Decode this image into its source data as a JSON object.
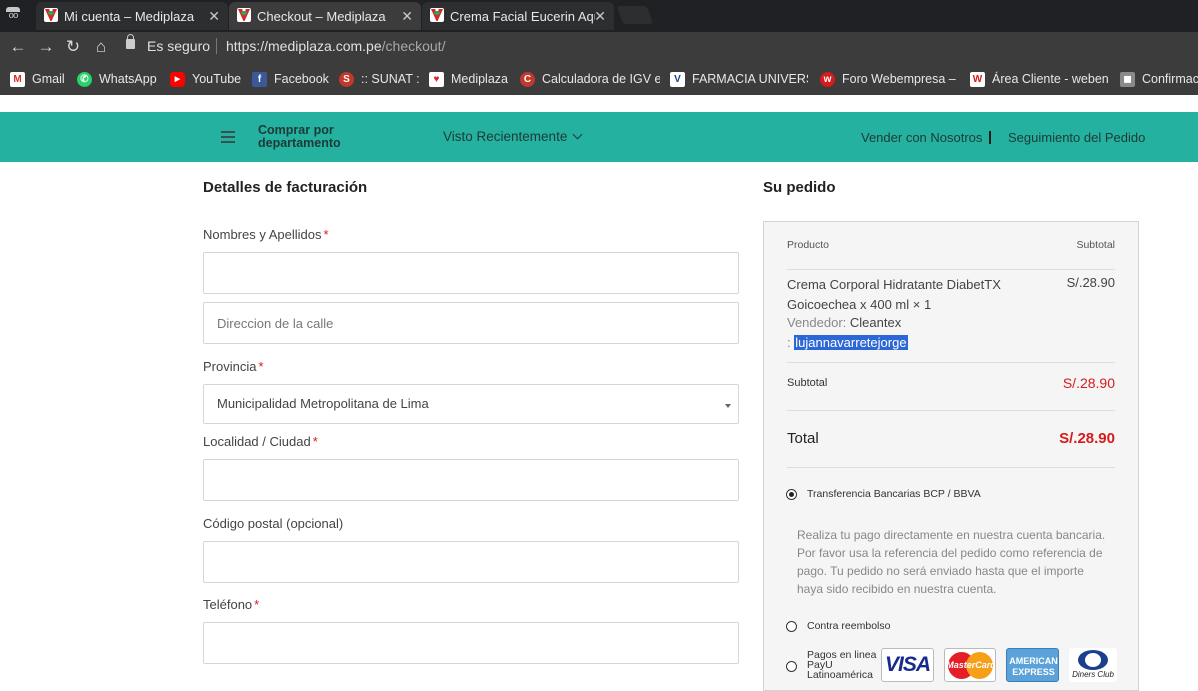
{
  "browser": {
    "tabs": [
      {
        "label": "Mi cuenta – Mediplaza",
        "active": false
      },
      {
        "label": "Checkout – Mediplaza",
        "active": true
      },
      {
        "label": "Crema Facial Eucerin Aqu",
        "active": false
      }
    ],
    "close_glyph": "✕",
    "nav": {
      "back": "←",
      "forward": "→",
      "reload": "↻",
      "home": "⌂"
    },
    "address": {
      "secure_label": "Es seguro",
      "url_host": "https://mediplaza.com.pe",
      "url_path": "/checkout/"
    },
    "bookmarks": [
      {
        "label": "Gmail",
        "icon": "gmail-icon",
        "color": "#d93025",
        "glyph": "M"
      },
      {
        "label": "WhatsApp",
        "icon": "whatsapp-icon",
        "color": "#25d366",
        "glyph": "✆"
      },
      {
        "label": "YouTube",
        "icon": "youtube-icon",
        "color": "#ff0000",
        "glyph": "▶"
      },
      {
        "label": "Facebook",
        "icon": "facebook-icon",
        "color": "#3b5998",
        "glyph": "f"
      },
      {
        "label": ":: SUNAT ::",
        "icon": "sunat-icon",
        "color": "#c0392b",
        "glyph": "S"
      },
      {
        "label": "Mediplaza",
        "icon": "mediplaza-icon",
        "color": "#d7262b",
        "glyph": "♥"
      },
      {
        "label": "Calculadora de IGV e",
        "icon": "calculator-icon",
        "color": "#c0392b",
        "glyph": "C"
      },
      {
        "label": "FARMACIA UNIVERSA",
        "icon": "farmacia-icon",
        "color": "#1a3f8c",
        "glyph": "V"
      },
      {
        "label": "Foro Webempresa – F",
        "icon": "webempresa-icon",
        "color": "#d51b1b",
        "glyph": "w"
      },
      {
        "label": "Área Cliente - weben",
        "icon": "webempresa-client-icon",
        "color": "#d51b1b",
        "glyph": "W"
      },
      {
        "label": "Confirmac",
        "icon": "profile-icon",
        "color": "#8a8a8a",
        "glyph": "◼"
      }
    ]
  },
  "site_header": {
    "departments": "Comprar por departamento",
    "recent": "Visto Recientemente",
    "sell": "Vender con Nosotros",
    "separator": "|",
    "track": "Seguimiento del Pedido"
  },
  "billing": {
    "title": "Detalles de facturación",
    "fields": {
      "name_label": "Nombres y Apellidos",
      "address_placeholder": "Direccion de la calle",
      "province_label": "Provincia",
      "province_value": "Municipalidad Metropolitana de Lima",
      "city_label": "Localidad / Ciudad",
      "postal_label": "Código postal (opcional)",
      "phone_label": "Teléfono"
    },
    "required_mark": "*"
  },
  "order": {
    "title": "Su pedido",
    "col_product": "Producto",
    "col_subtotal": "Subtotal",
    "product_name": "Crema Corporal Hidratante DiabetTX Goicoechea x 400 ml",
    "product_qty": "× 1",
    "product_price": "S/.28.90",
    "vendor_label": "Vendedor:",
    "vendor_name": "Cleantex",
    "vendor_user_prefix": ":",
    "vendor_user": "lujannavarretejorge",
    "subtotal_label": "Subtotal",
    "subtotal_value": "S/.28.90",
    "total_label": "Total",
    "total_value": "S/.28.90",
    "payment_methods": [
      {
        "label": "Transferencia Bancarias BCP / BBVA",
        "selected": true
      },
      {
        "label": "Contra reembolso",
        "selected": false
      },
      {
        "label": "Pagos en linea PayU Latinoamérica",
        "selected": false
      }
    ],
    "transfer_description": "Realiza tu pago directamente en nuestra cuenta bancaria. Por favor usa la referencia del pedido como referencia de pago. Tu pedido no será enviado hasta que el importe haya sido recibido en nuestra cuenta.",
    "card_logos": {
      "visa": "VISA",
      "mastercard": "MasterCard",
      "amex_top": "AMERICAN",
      "amex_bottom": "EXPRESS",
      "diners": "Diners Club"
    },
    "accent_color": "#d51b1b"
  },
  "colors": {
    "header_teal": "#24b1a0",
    "chrome_dark": "#3c3c3c"
  }
}
